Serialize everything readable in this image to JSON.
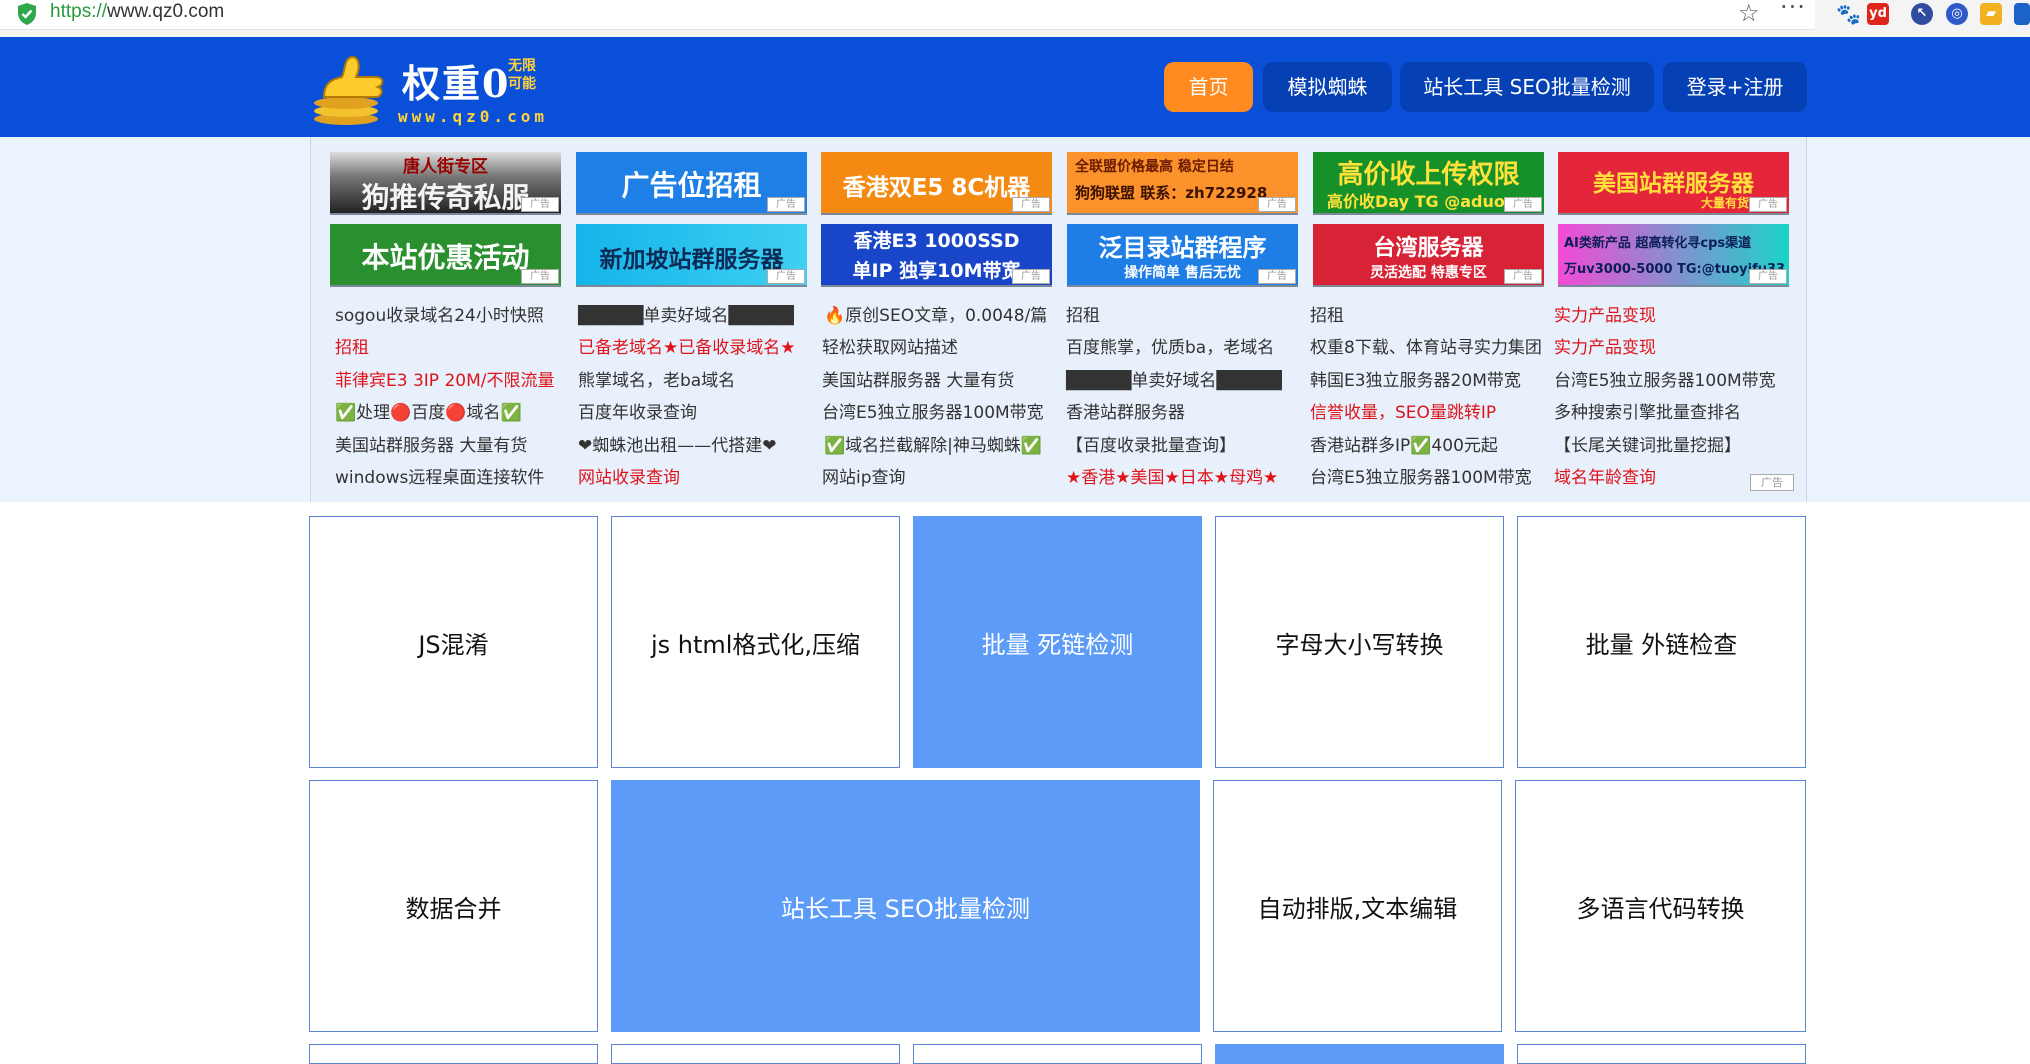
{
  "browser": {
    "url_protocol": "https://",
    "url_host": "www.qz0.com",
    "extensions": [
      "paw-icon",
      "youdao-icon",
      "cursor-icon",
      "account-icon",
      "folder-icon",
      "puzzle-icon"
    ]
  },
  "header": {
    "logo_title": "权重0",
    "logo_tagline_1": "无限",
    "logo_tagline_2": "可能",
    "logo_domain": "www.qz0.com",
    "nav": [
      {
        "label": "首页",
        "active": true
      },
      {
        "label": "模拟蜘蛛",
        "active": false
      },
      {
        "label": "站长工具 SEO批量检测",
        "active": false
      },
      {
        "label": "登录+注册",
        "active": false
      }
    ]
  },
  "ads": {
    "ad_tag": "广告",
    "banners_row1": [
      {
        "line1": "唐人街专区",
        "line2": "狗推传奇私服"
      },
      {
        "line1": "广告位招租",
        "line2": ""
      },
      {
        "line1": "香港双E5 8C机器",
        "line2": ""
      },
      {
        "line1": "全联盟价格最高 稳定日结",
        "line2": "狗狗联盟  联系：zh722928"
      },
      {
        "line1": "高价收上传权限",
        "line2": "高价收Day  TG @aduog"
      },
      {
        "line1": "美国站群服务器",
        "line2": "大量有货"
      }
    ],
    "banners_row2": [
      {
        "line1": "本站优惠活动",
        "line2": ""
      },
      {
        "line1": "新加坡站群服务器",
        "line2": ""
      },
      {
        "line1": "香港E3 1000SSD",
        "line2": "单IP 独享10M带宽"
      },
      {
        "line1": "泛目录站群程序",
        "line2": "操作简单  售后无忧"
      },
      {
        "line1": "台湾服务器",
        "line2": "灵活选配    特惠专区"
      },
      {
        "line1": "AI类新产品 超高转化寻cps渠道",
        "line2": "万uv3000-5000 TG:@tuoyifu33"
      }
    ],
    "text_columns": [
      [
        {
          "text": "sogou收录域名24小时快照",
          "red": false
        },
        {
          "text": "招租",
          "red": true
        },
        {
          "text": "菲律宾E3 3IP 20M/不限流量",
          "red": true
        },
        {
          "text": "✅处理🔴百度🔴域名✅",
          "red": false
        },
        {
          "text": "美国站群服务器 大量有货",
          "red": false
        },
        {
          "text": "windows远程桌面连接软件",
          "red": false
        }
      ],
      [
        {
          "text": "█████单卖好域名█████",
          "red": false
        },
        {
          "text": "已备老域名★已备收录域名★",
          "red": true
        },
        {
          "text": "熊掌域名，老ba域名",
          "red": false
        },
        {
          "text": "百度年收录查询",
          "red": false
        },
        {
          "text": "❤蜘蛛池出租——代搭建❤",
          "red": false
        },
        {
          "text": "网站收录查询",
          "red": true
        }
      ],
      [
        {
          "text": "🔥原创SEO文章，0.0048/篇",
          "red": false
        },
        {
          "text": "轻松获取网站描述",
          "red": false
        },
        {
          "text": "美国站群服务器 大量有货",
          "red": false
        },
        {
          "text": "台湾E5独立服务器100M带宽",
          "red": false
        },
        {
          "text": "✅域名拦截解除|神马蜘蛛✅",
          "red": false
        },
        {
          "text": "网站ip查询",
          "red": false
        }
      ],
      [
        {
          "text": "招租",
          "red": false
        },
        {
          "text": "百度熊掌，优质ba，老域名",
          "red": false
        },
        {
          "text": "█████单卖好域名█████",
          "red": false
        },
        {
          "text": "香港站群服务器",
          "red": false
        },
        {
          "text": "【百度收录批量查询】",
          "red": false
        },
        {
          "text": "★香港★美国★日本★母鸡★",
          "red": true
        }
      ],
      [
        {
          "text": "招租",
          "red": false
        },
        {
          "text": "权重8下载、体育站寻实力集团",
          "red": false
        },
        {
          "text": "韩国E3独立服务器20M带宽",
          "red": false
        },
        {
          "text": "信誉收量，SEO量跳转IP",
          "red": true
        },
        {
          "text": "香港站群多IP✅400元起",
          "red": false
        },
        {
          "text": "台湾E5独立服务器100M带宽",
          "red": false
        }
      ],
      [
        {
          "text": "实力产品变现",
          "red": true
        },
        {
          "text": "实力产品变现",
          "red": true
        },
        {
          "text": "台湾E5独立服务器100M带宽",
          "red": false
        },
        {
          "text": "多种搜索引擎批量查排名",
          "red": false
        },
        {
          "text": "【长尾关键词批量挖掘】",
          "red": false
        },
        {
          "text": "域名年龄查询",
          "red": true
        }
      ]
    ]
  },
  "tools": {
    "row1": [
      {
        "label": "JS混淆",
        "highlight": false
      },
      {
        "label": "js html格式化,压缩",
        "highlight": false
      },
      {
        "label": "批量 死链检测",
        "highlight": true
      },
      {
        "label": "字母大小写转换",
        "highlight": false
      },
      {
        "label": "批量 外链检查",
        "highlight": false
      }
    ],
    "row2": [
      {
        "label": "数据合并",
        "highlight": false
      },
      {
        "label": "站长工具 SEO批量检测",
        "highlight": true
      },
      {
        "label": "自动排版,文本编辑",
        "highlight": false
      },
      {
        "label": "多语言代码转换",
        "highlight": false
      }
    ]
  },
  "colors": {
    "header_blue": "#0a4fd8",
    "nav_active": "#ff8a1f",
    "tile_highlight": "#5c9cf8",
    "ad_red": "#e0131b"
  }
}
